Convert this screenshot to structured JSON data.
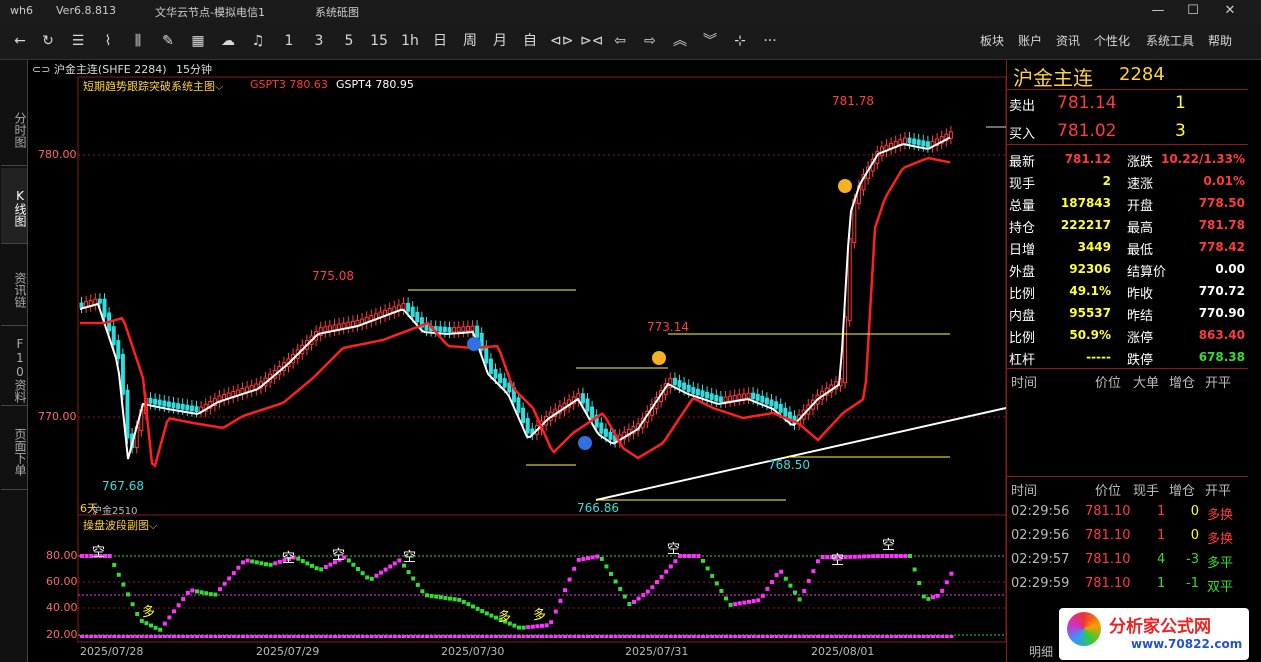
{
  "window": {
    "app": "wh6",
    "version": "Ver6.8.813",
    "account": "文华云节点-模拟电信1",
    "mode": "系统砥图"
  },
  "toolbar": {
    "periods": [
      "1",
      "3",
      "5",
      "15",
      "1h",
      "日",
      "周",
      "月",
      "自"
    ],
    "menu": [
      "板块",
      "账户",
      "资讯",
      "个性化",
      "系统工具",
      "帮助"
    ]
  },
  "left_tabs": [
    "分时图",
    "K线图",
    "资讯链",
    "F10资料",
    "页面下单"
  ],
  "chart_header": {
    "instrument": "沪金主连(SHFE 2284)",
    "period": "15分钟",
    "indicator": "短期趋势跟踪突破系统主图",
    "gspt3": "GSPT3 780.63",
    "gspt4": "GSPT4 780.95"
  },
  "chart_labels": {
    "price_780": "780.00",
    "price_770": "770.00",
    "high_781": "781.78",
    "high_775": "775.08",
    "high_773": "773.14",
    "low_767": "767.68",
    "low_766": "766.86",
    "low_768": "768.50",
    "days": "6天",
    "sub_contract": "沪金2510"
  },
  "sub_chart": {
    "title": "操盘波段副图",
    "levels": [
      "80.00",
      "60.00",
      "40.00",
      "20.00"
    ],
    "kong": "空",
    "duo": "多"
  },
  "x_dates": [
    "2025/07/28",
    "2025/07/29",
    "2025/07/30",
    "2025/07/31",
    "2025/08/01"
  ],
  "quote": {
    "name": "沪金主连",
    "code": "2284",
    "sell_label": "卖出",
    "sell_price": "781.14",
    "sell_vol": "1",
    "buy_label": "买入",
    "buy_price": "781.02",
    "buy_vol": "3",
    "rows": [
      {
        "l1": "最新",
        "v1": "781.12",
        "l2": "涨跌",
        "v2": "10.22/1.33%"
      },
      {
        "l1": "现手",
        "v1": "2",
        "l2": "速涨",
        "v2": "0.01%"
      },
      {
        "l1": "总量",
        "v1": "187843",
        "l2": "开盘",
        "v2": "778.50"
      },
      {
        "l1": "持仓",
        "v1": "222217",
        "l2": "最高",
        "v2": "781.78"
      },
      {
        "l1": "日增",
        "v1": "3449",
        "l2": "最低",
        "v2": "778.42"
      },
      {
        "l1": "外盘",
        "v1": "92306",
        "l2": "结算价",
        "v2": "0.00"
      },
      {
        "l1": "比例",
        "v1": "49.1%",
        "l2": "昨收",
        "v2": "770.72"
      },
      {
        "l1": "内盘",
        "v1": "95537",
        "l2": "昨结",
        "v2": "770.90"
      },
      {
        "l1": "比例",
        "v1": "50.9%",
        "l2": "涨停",
        "v2": "863.40"
      },
      {
        "l1": "杠杆",
        "v1": "-----",
        "l2": "跌停",
        "v2": "678.38"
      }
    ],
    "big_order_header": [
      "时间",
      "价位",
      "大单",
      "增仓",
      "开平"
    ],
    "tick_header": [
      "时间",
      "价位",
      "现手",
      "增仓",
      "开平"
    ],
    "ticks": [
      {
        "t": "02:29:56",
        "p": "781.10",
        "v": "1",
        "z": "0",
        "k": "多换"
      },
      {
        "t": "02:29:56",
        "p": "781.10",
        "v": "1",
        "z": "0",
        "k": "多换"
      },
      {
        "t": "02:29:57",
        "p": "781.10",
        "v": "4",
        "z": "-3",
        "k": "多平"
      },
      {
        "t": "02:29:59",
        "p": "781.10",
        "v": "1",
        "z": "-1",
        "k": "双平"
      }
    ],
    "bottom_label": "明细"
  },
  "watermark": {
    "name": "分析家公式网",
    "url": "www.70822.com"
  }
}
